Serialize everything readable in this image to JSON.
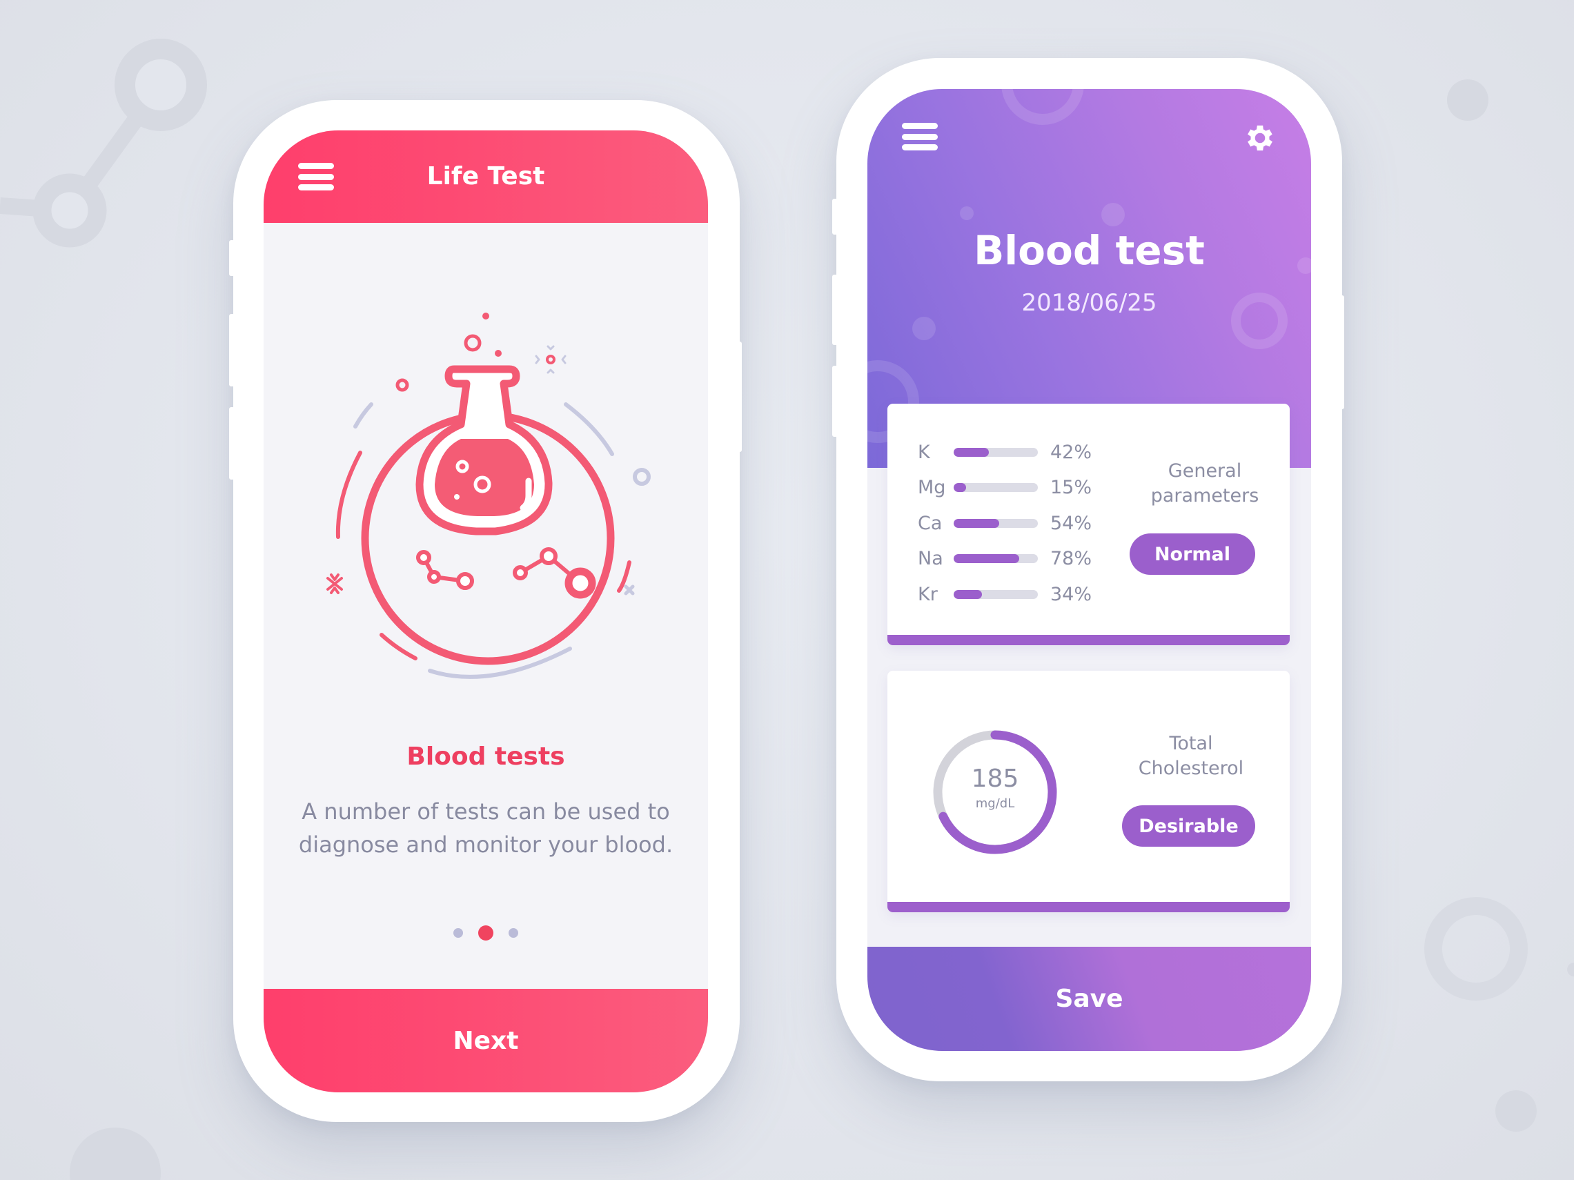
{
  "colors": {
    "pink_accent": "#fe3f6c",
    "pink_title": "#ee3f60",
    "purple_accent": "#9b5fcc",
    "purple_header_start": "#7c69d8",
    "purple_header_end": "#c67ee6",
    "muted_text": "#8c8ea3",
    "track_gray": "#dcdce6"
  },
  "left_phone": {
    "header": {
      "title": "Life Test",
      "menu_icon": "hamburger-menu-icon"
    },
    "illustration": {
      "icon": "chemistry-flask-icon"
    },
    "onboarding": {
      "title": "Blood tests",
      "description_line1": "A number of tests can be used to",
      "description_line2": "diagnose and monitor your blood."
    },
    "pager": {
      "total": 3,
      "active_index": 1
    },
    "next_button": {
      "label": "Next"
    }
  },
  "right_phone": {
    "header": {
      "menu_icon": "hamburger-menu-icon",
      "settings_icon": "gear-icon",
      "title": "Blood test",
      "date": "2018/06/25"
    },
    "general_parameters": {
      "label_line1": "General",
      "label_line2": "parameters",
      "status": "Normal",
      "items": [
        {
          "name": "K",
          "percent": 42,
          "label": "42%"
        },
        {
          "name": "Mg",
          "percent": 15,
          "label": "15%"
        },
        {
          "name": "Ca",
          "percent": 54,
          "label": "54%"
        },
        {
          "name": "Na",
          "percent": 78,
          "label": "78%"
        },
        {
          "name": "Kr",
          "percent": 34,
          "label": "34%"
        }
      ]
    },
    "cholesterol": {
      "label_line1": "Total",
      "label_line2": "Cholesterol",
      "value": "185",
      "unit": "mg/dL",
      "gauge_fraction": 0.68,
      "status": "Desirable"
    },
    "save_button": {
      "label": "Save"
    }
  }
}
